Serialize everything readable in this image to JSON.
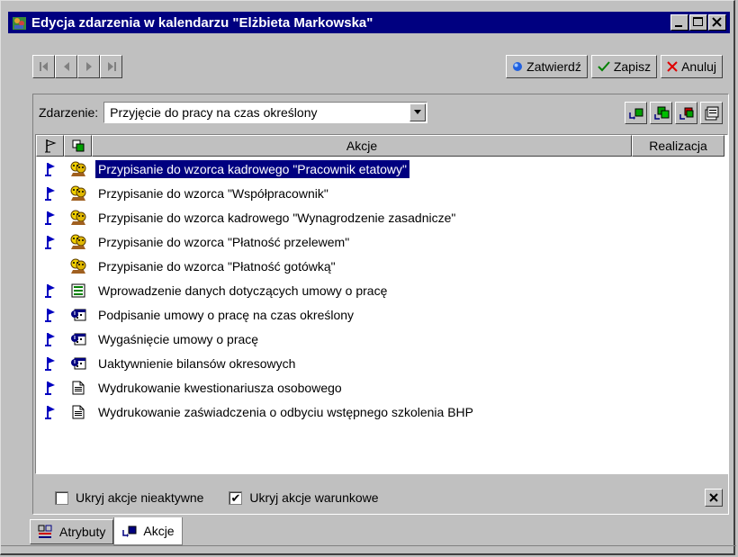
{
  "window": {
    "title": "Edycja zdarzenia w kalendarzu \"Elżbieta Markowska\""
  },
  "nav_buttons": [
    "first",
    "previous",
    "next",
    "last"
  ],
  "actions": {
    "confirm_label": "Zatwierdź",
    "save_label": "Zapisz",
    "cancel_label": "Anuluj"
  },
  "event": {
    "label": "Zdarzenie:",
    "value": "Przyjęcie do pracy na czas określony"
  },
  "table": {
    "headers": {
      "actions": "Akcje",
      "realization": "Realizacja"
    },
    "rows": [
      {
        "flag": true,
        "icon": "people",
        "text": "Przypisanie do wzorca kadrowego \"Pracownik etatowy\"",
        "selected": true
      },
      {
        "flag": true,
        "icon": "people",
        "text": "Przypisanie do wzorca \"Współpracownik\""
      },
      {
        "flag": true,
        "icon": "people",
        "text": "Przypisanie do wzorca kadrowego \"Wynagrodzenie zasadnicze\""
      },
      {
        "flag": true,
        "icon": "people",
        "text": "Przypisanie do wzorca \"Płatność przelewem\""
      },
      {
        "flag": false,
        "icon": "people",
        "text": "Przypisanie do wzorca \"Płatność gotówką\""
      },
      {
        "flag": true,
        "icon": "form",
        "text": "Wprowadzenie danych dotyczących umowy o pracę"
      },
      {
        "flag": true,
        "icon": "calendar",
        "text": "Podpisanie umowy o pracę na czas określony"
      },
      {
        "flag": true,
        "icon": "calendar",
        "text": "Wygaśnięcie umowy o pracę"
      },
      {
        "flag": true,
        "icon": "calendar",
        "text": "Uaktywnienie bilansów okresowych"
      },
      {
        "flag": true,
        "icon": "document",
        "text": "Wydrukowanie kwestionariusza osobowego"
      },
      {
        "flag": true,
        "icon": "document",
        "text": "Wydrukowanie zaświadczenia o odbyciu wstępnego szkolenia BHP"
      }
    ]
  },
  "options": {
    "hide_inactive": {
      "label": "Ukryj akcje nieaktywne",
      "checked": false
    },
    "hide_conditional": {
      "label": "Ukryj akcje warunkowe",
      "checked": true
    }
  },
  "tabs": [
    {
      "label": "Atrybuty",
      "active": false
    },
    {
      "label": "Akcje",
      "active": true
    }
  ],
  "colors": {
    "title_bg": "#000080",
    "selection": "#000080",
    "face": "#c0c0c0"
  }
}
